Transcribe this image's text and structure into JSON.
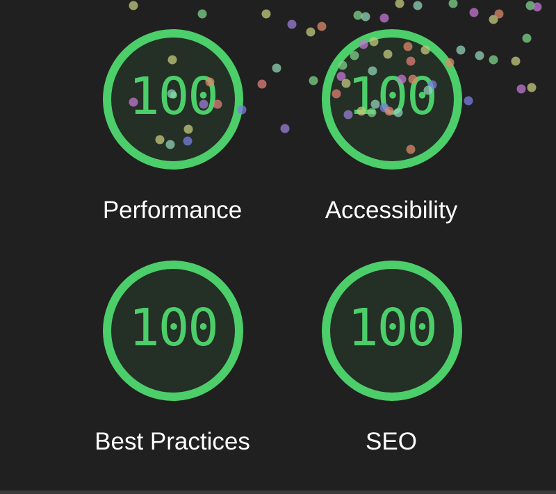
{
  "report": {
    "categories": [
      {
        "name": "Performance",
        "score": "100"
      },
      {
        "name": "Accessibility",
        "score": "100"
      },
      {
        "name": "Best Practices",
        "score": "100"
      },
      {
        "name": "SEO",
        "score": "100"
      }
    ]
  },
  "colors": {
    "background": "#202020",
    "pass": "#4cce6a",
    "label": "#ffffff"
  },
  "confetti": {
    "palette": [
      "#e07f77",
      "#c3c97c",
      "#8fd1b6",
      "#9b7ed6",
      "#c177d1",
      "#7a7fe0",
      "#7fd18a",
      "#d98a6b"
    ]
  }
}
